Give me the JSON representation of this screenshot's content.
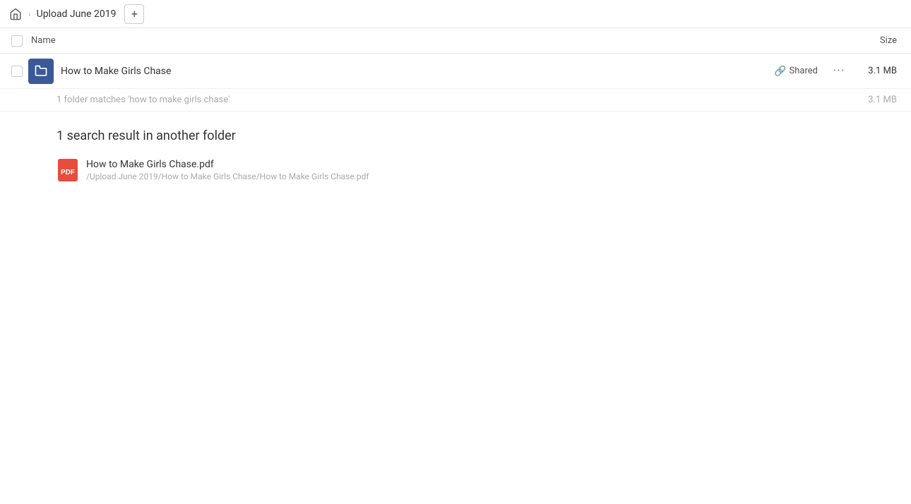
{
  "header": {
    "home_label": "Home",
    "breadcrumb_folder": "Upload June 2019",
    "add_button_label": "+"
  },
  "columns": {
    "name_label": "Name",
    "size_label": "Size"
  },
  "folder_row": {
    "name": "How to Make Girls Chase",
    "shared_label": "Shared",
    "size": "3.1 MB"
  },
  "summary": {
    "text": "1 folder matches 'how to make girls chase'",
    "size": "3.1 MB"
  },
  "other_results": {
    "heading": "1 search result in another folder",
    "file": {
      "name": "How to Make Girls Chase.pdf",
      "path": "/Upload June 2019/How to Make Girls Chase/How to Make Girls Chase.pdf"
    }
  }
}
